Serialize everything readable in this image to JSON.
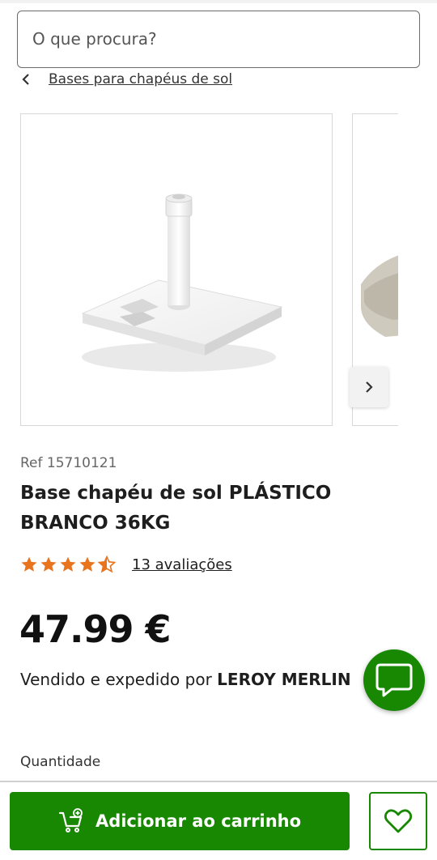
{
  "search": {
    "placeholder": "O que procura?"
  },
  "breadcrumb": {
    "label": "Bases para chapéus de sol",
    "icon": "chevron-left-icon"
  },
  "carousel": {
    "next_icon": "chevron-right-icon"
  },
  "product": {
    "ref": "Ref 15710121",
    "title": "Base chapéu de sol PLÁSTICO BRANCO 36KG",
    "rating": 4.5,
    "rating_max": 5,
    "reviews_label": "13 avaliações",
    "price": "47.99 €",
    "seller_prefix": "Vendido e expedido por ",
    "seller_name": "LEROY MERLIN"
  },
  "quantity": {
    "label": "Quantidade"
  },
  "actions": {
    "add_to_cart_label": "Adicionar ao carrinho",
    "cart_icon": "cart-add-icon",
    "favorite_icon": "heart-icon",
    "chat_icon": "chat-icon"
  },
  "colors": {
    "brand_green": "#188803",
    "star_orange": "#e8741e"
  }
}
